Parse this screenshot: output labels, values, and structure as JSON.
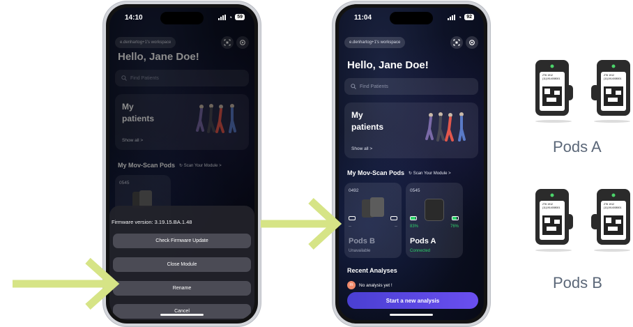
{
  "phone_left": {
    "time": "14:10",
    "battery": "59",
    "workspace": "e.denhartog+1's workspace",
    "greeting": "Hello, Jane Doe!",
    "search_placeholder": "Find Patients",
    "patients_title_line1": "My",
    "patients_title_line2": "patients",
    "show_all": "Show all >",
    "pods_section": "My Mov-Scan Pods",
    "scan_link": "Scan Your Module >",
    "pod_code": "0545",
    "firmware_text": "Firmware version: 3.19.15.BA.1.48",
    "actions": [
      "Check Firmware Update",
      "Close Module",
      "Rename",
      "Cancel"
    ]
  },
  "phone_right": {
    "time": "11:04",
    "battery": "92",
    "workspace": "e.denhartog+1's workspace",
    "greeting": "Hello, Jane Doe!",
    "search_placeholder": "Find Patients",
    "patients_title_line1": "My",
    "patients_title_line2": "patients",
    "show_all": "Show all >",
    "pods_section": "My Mov-Scan Pods",
    "scan_link": "Scan Your Module >",
    "pods": [
      {
        "code": "0492",
        "name": "Pods B",
        "status": "Unavailable",
        "left_batt": "--",
        "right_batt": "--",
        "left_level": 0,
        "right_level": 0
      },
      {
        "code": "0545",
        "name": "Pods A",
        "status": "Connected",
        "left_batt": "83%",
        "right_batt": "76%",
        "left_level": 0.83,
        "right_level": 0.76
      }
    ],
    "recent_title": "Recent Analyses",
    "recent_empty": "No analysis yet !",
    "avatar_letter": "m",
    "start_button": "Start a new analysis"
  },
  "pods_groups": [
    {
      "label": "Pods A",
      "tag_line1": "ZT6   1912",
      "tag_line2": "(11)1914008001"
    },
    {
      "label": "Pods B",
      "tag_line1": "ZT6   1912",
      "tag_line2": "(11)1914008001"
    }
  ],
  "colors": {
    "arrow": "#d6e486",
    "connected": "#2fd16b",
    "unavailable": "#9aa0b4",
    "accent": "#5a47e6"
  }
}
